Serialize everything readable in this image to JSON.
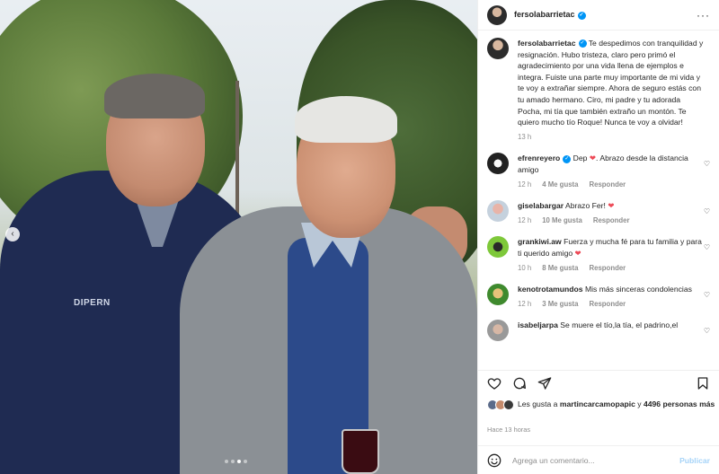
{
  "post": {
    "username": "fersolabarrietac",
    "caption": "Te despedimos con tranquilidad y resignación. Hubo tristeza, claro pero primó el agradecimiento por una vida llena de ejemplos e integra. Fuiste una parte muy importante de mi vida y te voy a extrañar siempre. Ahora de seguro estás con tu amado hermano. Ciro, mi padre y tu adorada Pocha, mi tía que también extraño un montón. Te quiero mucho tío Roque! Nunca te voy a olvidar!",
    "caption_time": "13 h",
    "photo_logo": "DIPERN"
  },
  "comments": [
    {
      "user": "efrenreyero",
      "verified": true,
      "text_before": " Dep ",
      "heart": "❤",
      "text_after": ". Abrazo desde la distancia amigo",
      "time": "12 h",
      "likes": "4 Me gusta",
      "reply": "Responder"
    },
    {
      "user": "giselabargar",
      "verified": false,
      "text_before": " Abrazo Fer! ",
      "heart": "❤",
      "text_after": "",
      "time": "12 h",
      "likes": "10 Me gusta",
      "reply": "Responder"
    },
    {
      "user": "grankiwi.aw",
      "verified": false,
      "text_before": " Fuerza y mucha fé para tu familia y para ti querido amigo ",
      "heart": "❤",
      "text_after": "",
      "time": "10 h",
      "likes": "8 Me gusta",
      "reply": "Responder"
    },
    {
      "user": "kenotrotamundos",
      "verified": false,
      "text_before": " Mis más sinceras condolencias",
      "heart": "",
      "text_after": "",
      "time": "12 h",
      "likes": "3 Me gusta",
      "reply": "Responder"
    },
    {
      "user": "isabeljarpa",
      "verified": false,
      "text_before": " Se muere el tío,la tía, el padrino,el",
      "heart": "",
      "text_after": "",
      "time": "",
      "likes": "",
      "reply": ""
    }
  ],
  "likes_line": {
    "prefix": "Les gusta a ",
    "user": "martincarcamopapic",
    "middle": " y ",
    "count": "4496 personas más"
  },
  "timestamp": "Hace 13 horas",
  "comment_box": {
    "placeholder": "Agrega un comentario...",
    "post_label": "Publicar"
  },
  "icons": {
    "more": "more-options-icon",
    "like": "heart-icon",
    "comment": "comment-icon",
    "share": "share-icon",
    "save": "bookmark-icon",
    "emoji": "emoji-icon"
  },
  "colors": {
    "verified": "#0095f6",
    "heart": "#ed4956",
    "post_button": "#a5d3f8",
    "muted": "#8e8e8e"
  }
}
